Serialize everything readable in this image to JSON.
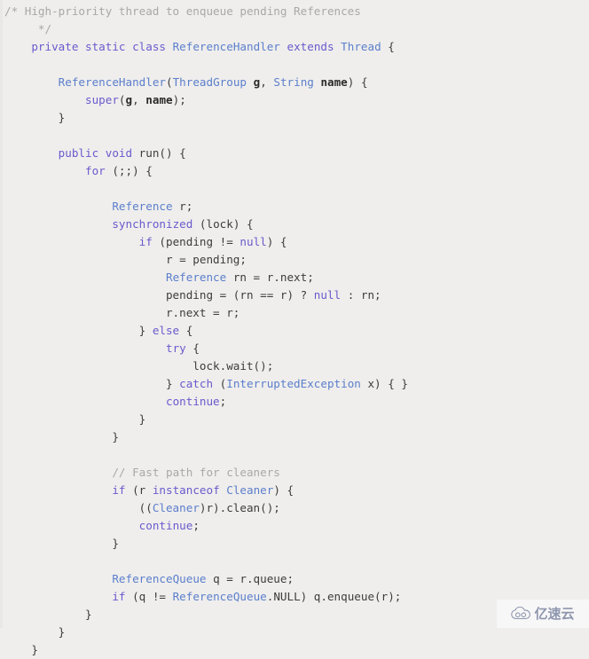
{
  "viewer": {
    "name": "code-snippet-viewer",
    "language": "java",
    "background_color": "#efeeec",
    "font_size_px": 12.6,
    "line_height_px": 20
  },
  "colors": {
    "comment": "#a8a8a8",
    "keyword": "#6a5acd",
    "type": "#5b7ecc",
    "plain": "#3c3c3c",
    "parameter": "#2b2b2b",
    "background": "#efeeec",
    "watermark_text": "#8f96ae",
    "watermark_background": "#f7f7f7"
  },
  "watermark": {
    "icon": "cloud-icon",
    "text": "亿速云"
  },
  "code": {
    "lines": [
      [
        {
          "t": "/* High-priority thread to enqueue pending References",
          "c": "cmt"
        }
      ],
      [
        {
          "t": "     */",
          "c": "cmt"
        }
      ],
      [
        {
          "t": "    ",
          "c": "pln"
        },
        {
          "t": "private static class ",
          "c": "kw"
        },
        {
          "t": "ReferenceHandler ",
          "c": "typ"
        },
        {
          "t": "extends ",
          "c": "kw"
        },
        {
          "t": "Thread ",
          "c": "typ"
        },
        {
          "t": "{",
          "c": "pun"
        }
      ],
      [
        {
          "t": "",
          "c": "pln"
        }
      ],
      [
        {
          "t": "        ",
          "c": "pln"
        },
        {
          "t": "ReferenceHandler",
          "c": "typ"
        },
        {
          "t": "(",
          "c": "pun"
        },
        {
          "t": "ThreadGroup ",
          "c": "typ"
        },
        {
          "t": "g",
          "c": "prm"
        },
        {
          "t": ", ",
          "c": "pun"
        },
        {
          "t": "String ",
          "c": "typ"
        },
        {
          "t": "name",
          "c": "prm"
        },
        {
          "t": ") {",
          "c": "pun"
        }
      ],
      [
        {
          "t": "            ",
          "c": "pln"
        },
        {
          "t": "super",
          "c": "kw"
        },
        {
          "t": "(",
          "c": "pun"
        },
        {
          "t": "g",
          "c": "prm"
        },
        {
          "t": ", ",
          "c": "pun"
        },
        {
          "t": "name",
          "c": "prm"
        },
        {
          "t": ");",
          "c": "pun"
        }
      ],
      [
        {
          "t": "        }",
          "c": "pun"
        }
      ],
      [
        {
          "t": "",
          "c": "pln"
        }
      ],
      [
        {
          "t": "        ",
          "c": "pln"
        },
        {
          "t": "public void ",
          "c": "kw"
        },
        {
          "t": "run() {",
          "c": "pun"
        }
      ],
      [
        {
          "t": "            ",
          "c": "pln"
        },
        {
          "t": "for ",
          "c": "kw"
        },
        {
          "t": "(;;) {",
          "c": "pun"
        }
      ],
      [
        {
          "t": "",
          "c": "pln"
        }
      ],
      [
        {
          "t": "                ",
          "c": "pln"
        },
        {
          "t": "Reference ",
          "c": "typ"
        },
        {
          "t": "r;",
          "c": "pun"
        }
      ],
      [
        {
          "t": "                ",
          "c": "pln"
        },
        {
          "t": "synchronized ",
          "c": "kw"
        },
        {
          "t": "(lock) {",
          "c": "pun"
        }
      ],
      [
        {
          "t": "                    ",
          "c": "pln"
        },
        {
          "t": "if ",
          "c": "kw"
        },
        {
          "t": "(pending != ",
          "c": "pun"
        },
        {
          "t": "null",
          "c": "kw"
        },
        {
          "t": ") {",
          "c": "pun"
        }
      ],
      [
        {
          "t": "                        r = pending;",
          "c": "pun"
        }
      ],
      [
        {
          "t": "                        ",
          "c": "pln"
        },
        {
          "t": "Reference ",
          "c": "typ"
        },
        {
          "t": "rn = r.next;",
          "c": "pun"
        }
      ],
      [
        {
          "t": "                        pending = (rn == r) ? ",
          "c": "pun"
        },
        {
          "t": "null",
          "c": "kw"
        },
        {
          "t": " : rn;",
          "c": "pun"
        }
      ],
      [
        {
          "t": "                        r.next = r;",
          "c": "pun"
        }
      ],
      [
        {
          "t": "                    } ",
          "c": "pun"
        },
        {
          "t": "else ",
          "c": "kw"
        },
        {
          "t": "{",
          "c": "pun"
        }
      ],
      [
        {
          "t": "                        ",
          "c": "pln"
        },
        {
          "t": "try ",
          "c": "kw"
        },
        {
          "t": "{",
          "c": "pun"
        }
      ],
      [
        {
          "t": "                            lock.wait();",
          "c": "pun"
        }
      ],
      [
        {
          "t": "                        } ",
          "c": "pun"
        },
        {
          "t": "catch ",
          "c": "kw"
        },
        {
          "t": "(",
          "c": "pun"
        },
        {
          "t": "InterruptedException ",
          "c": "typ"
        },
        {
          "t": "x) { }",
          "c": "pun"
        }
      ],
      [
        {
          "t": "                        ",
          "c": "pln"
        },
        {
          "t": "continue",
          "c": "kw"
        },
        {
          "t": ";",
          "c": "pun"
        }
      ],
      [
        {
          "t": "                    }",
          "c": "pun"
        }
      ],
      [
        {
          "t": "                }",
          "c": "pun"
        }
      ],
      [
        {
          "t": "",
          "c": "pln"
        }
      ],
      [
        {
          "t": "                ",
          "c": "pln"
        },
        {
          "t": "// Fast path for cleaners",
          "c": "cmt"
        }
      ],
      [
        {
          "t": "                ",
          "c": "pln"
        },
        {
          "t": "if ",
          "c": "kw"
        },
        {
          "t": "(r ",
          "c": "pun"
        },
        {
          "t": "instanceof ",
          "c": "kw"
        },
        {
          "t": "Cleaner",
          "c": "typ"
        },
        {
          "t": ") {",
          "c": "pun"
        }
      ],
      [
        {
          "t": "                    ((",
          "c": "pun"
        },
        {
          "t": "Cleaner",
          "c": "typ"
        },
        {
          "t": ")r).clean();",
          "c": "pun"
        }
      ],
      [
        {
          "t": "                    ",
          "c": "pln"
        },
        {
          "t": "continue",
          "c": "kw"
        },
        {
          "t": ";",
          "c": "pun"
        }
      ],
      [
        {
          "t": "                }",
          "c": "pun"
        }
      ],
      [
        {
          "t": "",
          "c": "pln"
        }
      ],
      [
        {
          "t": "                ",
          "c": "pln"
        },
        {
          "t": "ReferenceQueue ",
          "c": "typ"
        },
        {
          "t": "q = r.queue;",
          "c": "pun"
        }
      ],
      [
        {
          "t": "                ",
          "c": "pln"
        },
        {
          "t": "if ",
          "c": "kw"
        },
        {
          "t": "(q != ",
          "c": "pun"
        },
        {
          "t": "ReferenceQueue",
          "c": "typ"
        },
        {
          "t": ".NULL) q.enqueue(r);",
          "c": "pun"
        }
      ],
      [
        {
          "t": "            }",
          "c": "pun"
        }
      ],
      [
        {
          "t": "        }",
          "c": "pun"
        }
      ],
      [
        {
          "t": "    }",
          "c": "pun"
        }
      ]
    ]
  }
}
